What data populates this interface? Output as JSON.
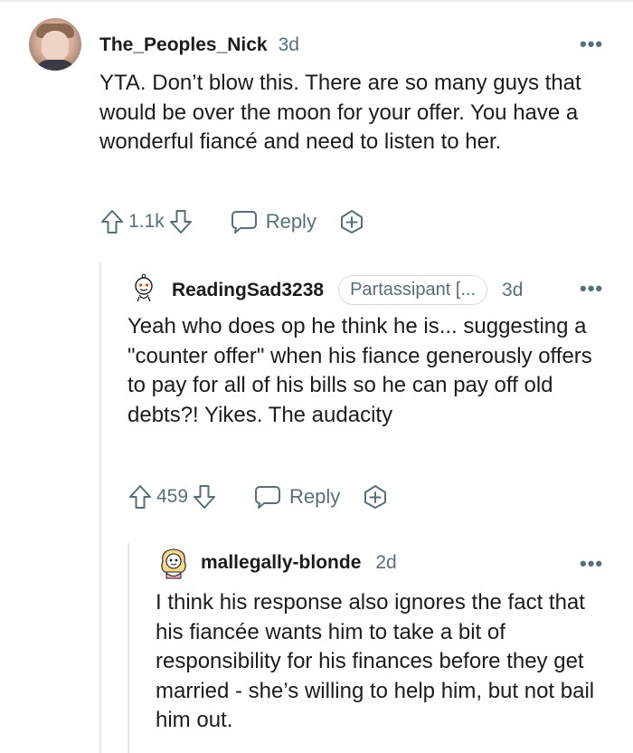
{
  "comments": [
    {
      "author": "The_Peoples_Nick",
      "time": "3d",
      "text": "YTA. Don’t blow this. There are so many guys that would be over the moon for your offer. You have a wonderful fiancé and need to listen to her.",
      "votes": "1.1k",
      "reply_label": "Reply",
      "avatar": "user-photo-avatar"
    },
    {
      "author": "ReadingSad3238",
      "flair": "Partassipant [...",
      "time": "3d",
      "text": "Yeah who does op he think he is... suggesting a \"counter offer\" when his fiance generously offers to pay for all of his bills so he can pay off old debts?! Yikes. The audacity",
      "votes": "459",
      "reply_label": "Reply",
      "avatar": "snoo-avatar"
    },
    {
      "author": "mallegally-blonde",
      "time": "2d",
      "text": "I think his response also ignores the fact that his fiancée wants him to take a bit of responsibility for his finances before they get married - she’s willing to help him, but not bail him out.",
      "avatar": "snoo-blonde-avatar"
    }
  ],
  "icons": {
    "upvote": "upvote-arrow-icon",
    "downvote": "downvote-arrow-icon",
    "reply": "chat-bubble-icon",
    "award": "award-plus-icon",
    "more": "more-dots-icon"
  },
  "colors": {
    "text": "#1c1c1c",
    "meta": "#576f76",
    "thread_line": "#e5e7ea"
  }
}
